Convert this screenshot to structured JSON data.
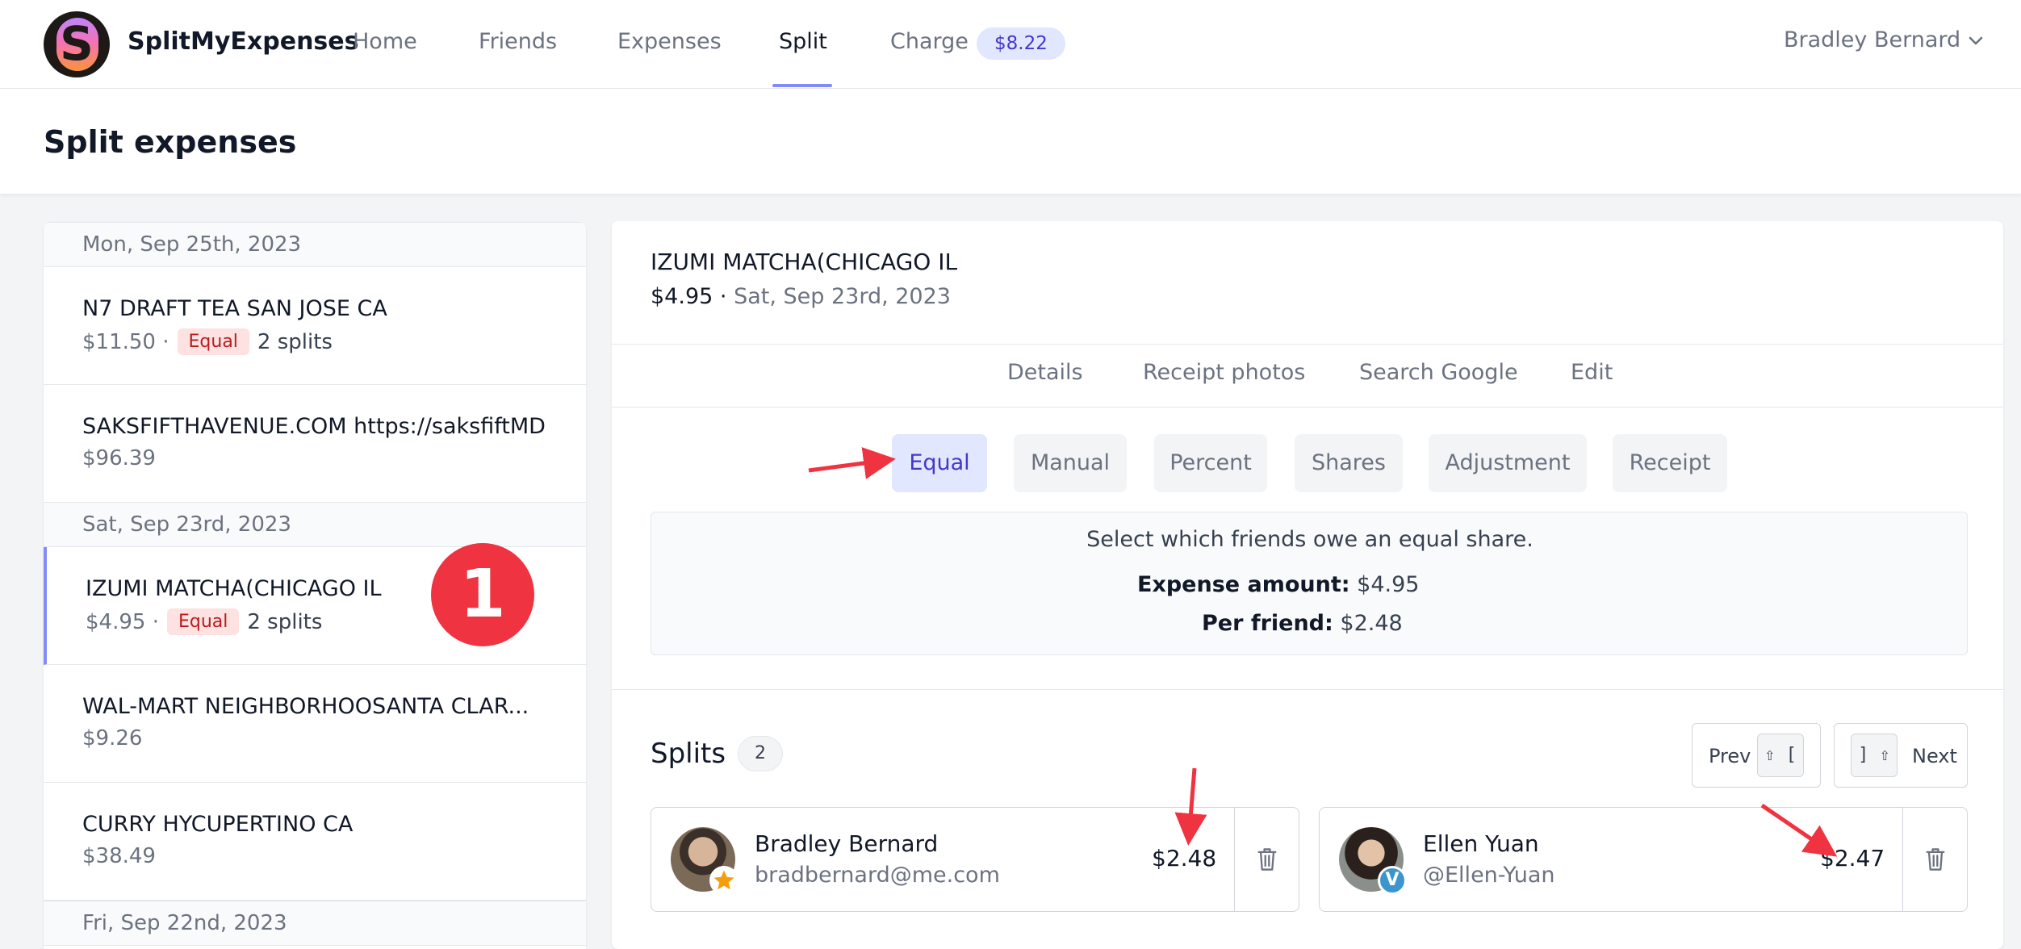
{
  "header": {
    "logo_letter": "S",
    "brand": "SplitMyExpenses",
    "nav": {
      "home": "Home",
      "friends": "Friends",
      "expenses": "Expenses",
      "split": "Split",
      "charge": "Charge",
      "charge_amount": "$8.22"
    },
    "user_name": "Bradley Bernard"
  },
  "page": {
    "title": "Split expenses"
  },
  "expense_list": {
    "groups": [
      {
        "date": "Mon, Sep 25th, 2023",
        "items": [
          {
            "name": "N7 DRAFT TEA SAN JOSE CA",
            "amount": "$11.50 ·",
            "tag": "Equal",
            "splits": "2 splits"
          },
          {
            "name": "SAKSFIFTHAVENUE.COM https://saksfiftMD",
            "amount": "$96.39"
          }
        ]
      },
      {
        "date": "Sat, Sep 23rd, 2023",
        "items": [
          {
            "name": "IZUMI MATCHA(CHICAGO IL",
            "amount": "$4.95 ·",
            "tag": "Equal",
            "splits": "2 splits",
            "selected": true
          },
          {
            "name": "WAL-MART NEIGHBORHOOSANTA CLAR...",
            "amount": "$9.26"
          },
          {
            "name": "CURRY HYCUPERTINO CA",
            "amount": "$38.49"
          }
        ]
      },
      {
        "date": "Fri, Sep 22nd, 2023",
        "items": []
      }
    ],
    "step_badge": "1"
  },
  "detail": {
    "title": "IZUMI MATCHA(CHICAGO IL",
    "amount": "$4.95 ·",
    "date": "Sat, Sep 23rd, 2023",
    "tabs": [
      "Details",
      "Receipt photos",
      "Search Google",
      "Edit"
    ],
    "modes": [
      "Equal",
      "Manual",
      "Percent",
      "Shares",
      "Adjustment",
      "Receipt"
    ],
    "active_mode": "Equal",
    "info": {
      "description": "Select which friends owe an equal share.",
      "expense_amount_label": "Expense amount:",
      "expense_amount_value": "$4.95",
      "per_friend_label": "Per friend:",
      "per_friend_value": "$2.48"
    }
  },
  "splits": {
    "title": "Splits",
    "count": "2",
    "prev_label": "Prev",
    "prev_key": "⇧ [",
    "next_label": "Next",
    "next_key": "] ⇧",
    "people": [
      {
        "name": "Bradley Bernard",
        "sub": "bradbernard@me.com",
        "amount": "$2.48",
        "badge": "star-icon"
      },
      {
        "name": "Ellen Yuan",
        "sub": "@Ellen-Yuan",
        "amount": "$2.47",
        "badge": "venmo-icon",
        "badge_letter": "V"
      }
    ]
  },
  "colors": {
    "accent": "#818cf8",
    "active_mode_bg": "#e0e7ff",
    "equal_tag_bg": "#fee2e2",
    "annotation_red": "#ef3340"
  }
}
